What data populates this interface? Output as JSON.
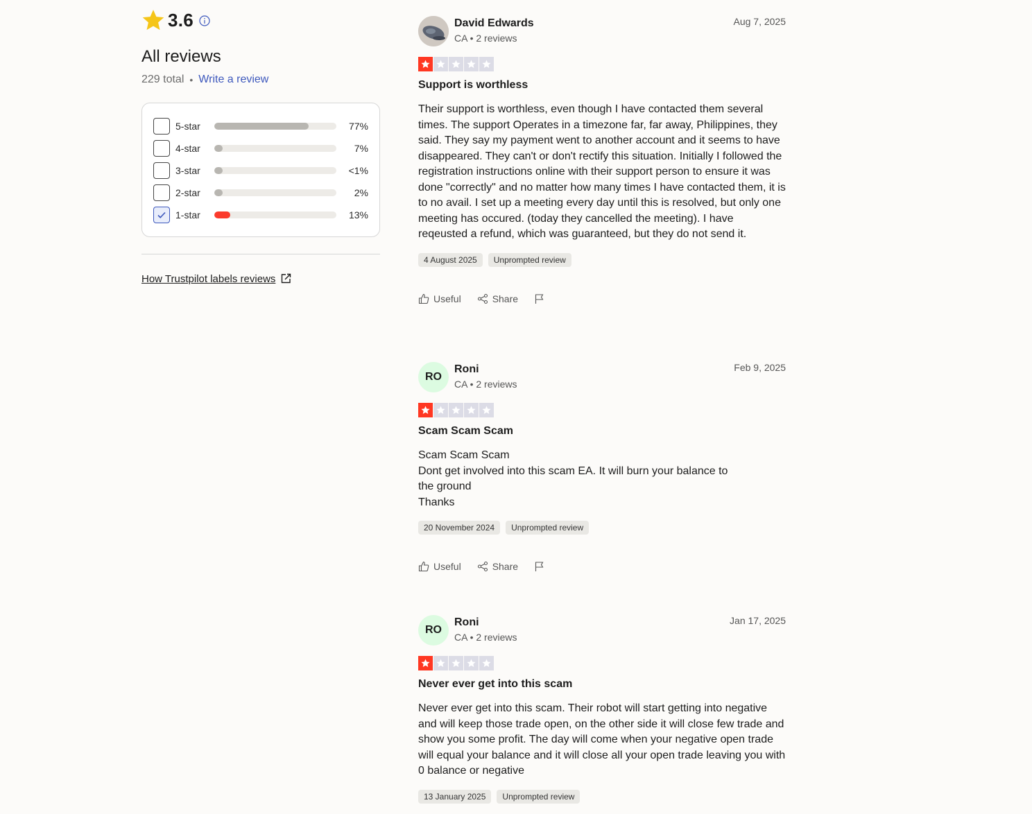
{
  "summary": {
    "rating": "3.6",
    "heading": "All reviews",
    "total": "229 total",
    "write_review": "Write a review",
    "labels_link": "How Trustpilot labels reviews"
  },
  "distribution": [
    {
      "label": "5-star",
      "pct": "77%",
      "fraction": 0.77,
      "checked": false
    },
    {
      "label": "4-star",
      "pct": "7%",
      "fraction": 0.07,
      "checked": false
    },
    {
      "label": "3-star",
      "pct": "<1%",
      "fraction": 0.01,
      "checked": false
    },
    {
      "label": "2-star",
      "pct": "2%",
      "fraction": 0.02,
      "checked": false
    },
    {
      "label": "1-star",
      "pct": "13%",
      "fraction": 0.13,
      "checked": true
    }
  ],
  "colors": {
    "accent_link": "#3c57bc",
    "star_red": "#ff3722",
    "star_gold": "#f5c518",
    "avatar_green": "#dcfbe1"
  },
  "actions": {
    "useful": "Useful",
    "share": "Share",
    "report_icon": "flag-icon"
  },
  "reviews": [
    {
      "name": "David Edwards",
      "meta": "CA • 2 reviews",
      "date": "Aug 7, 2025",
      "avatar": "photo",
      "initials": "",
      "stars": 1,
      "title": "Support is worthless",
      "body": "Their support is worthless, even though I have contacted them several times. The support Operates in a timezone far, far away, Philippines, they said. They say my payment went to another account and it seems to have disappeared. They can't or don't rectify this situation. Initially I followed the registration instructions online with their support person to ensure it was done \"correctly\" and no matter how many times I have contacted them, it is to no avail. I set up a meeting every day until this is resolved, but only one meeting has occured. (today they cancelled the meeting). I have reqeusted a refund, which was guaranteed, but they do not send it.",
      "experience_date": "4 August 2025",
      "label": "Unprompted review"
    },
    {
      "name": "Roni",
      "meta": "CA • 2 reviews",
      "date": "Feb 9, 2025",
      "avatar": "initials",
      "initials": "RO",
      "stars": 1,
      "title": "Scam Scam Scam",
      "body": "Scam Scam Scam\nDont get involved into this scam EA. It will burn your balance to\nthe ground\nThanks",
      "experience_date": "20 November 2024",
      "label": "Unprompted review"
    },
    {
      "name": "Roni",
      "meta": "CA • 2 reviews",
      "date": "Jan 17, 2025",
      "avatar": "initials",
      "initials": "RO",
      "stars": 1,
      "title": "Never ever get into this scam",
      "body": "Never ever get into this scam. Their robot will start getting into negative and will keep those trade open, on the other side it will close few trade and show you some profit. The day will come when your negative open trade will equal your balance and it will close all your open trade leaving you with 0 balance or negative",
      "experience_date": "13 January 2025",
      "label": "Unprompted review"
    }
  ]
}
